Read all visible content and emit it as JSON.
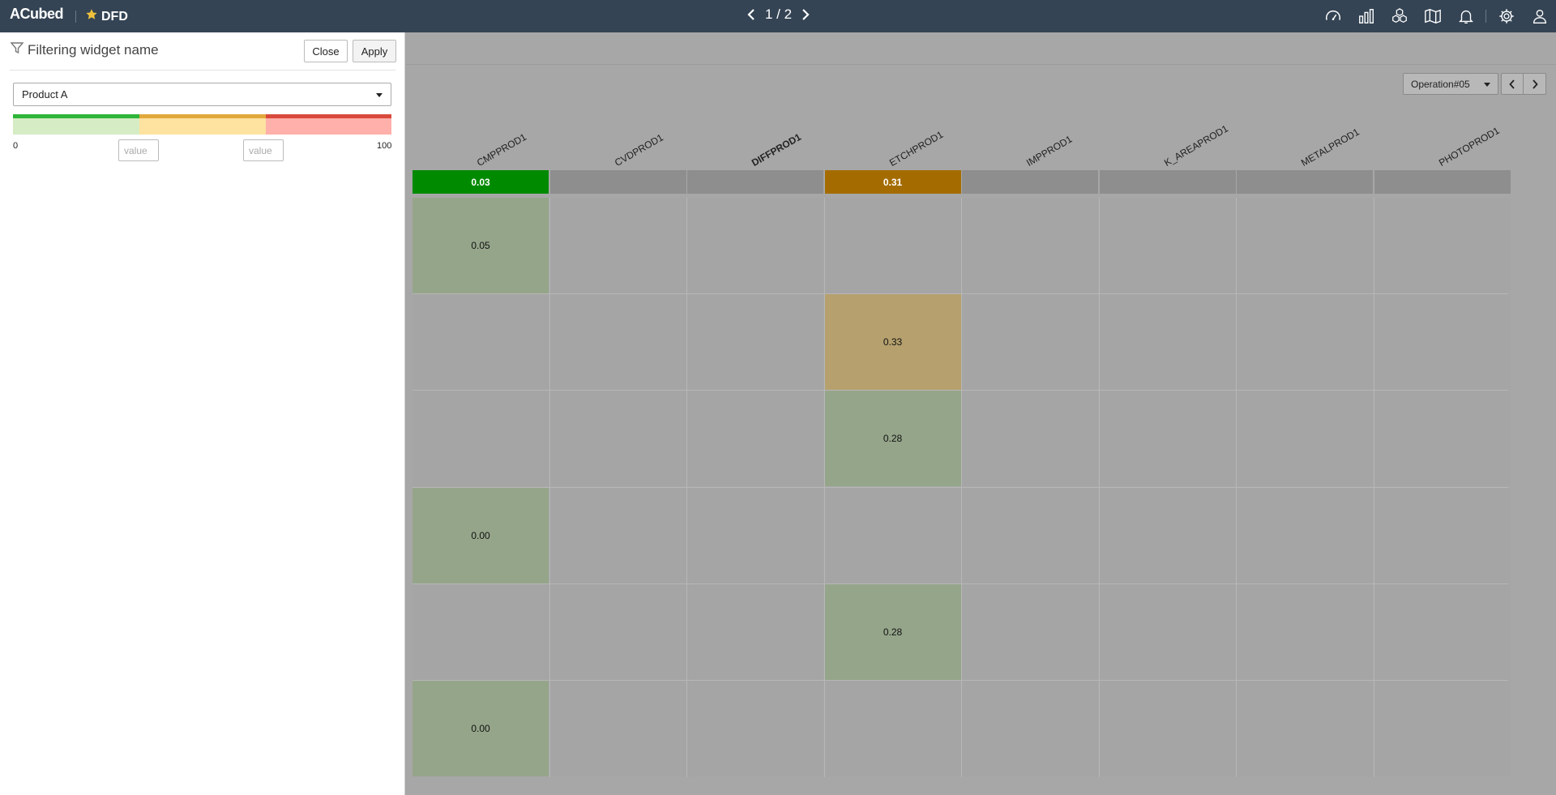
{
  "app": {
    "brand": "ACubed",
    "dashboard_title": "DFD"
  },
  "pager": {
    "label": "1 / 2"
  },
  "top_icons": [
    "speedometer-icon",
    "bar-chart-icon",
    "cubes-icon",
    "map-icon",
    "bell-icon",
    "gear-icon",
    "user-icon"
  ],
  "filter_panel": {
    "title": "Filtering widget name",
    "close_label": "Close",
    "apply_label": "Apply",
    "product_select": "Product A",
    "range_min": "0",
    "range_max": "100",
    "value_placeholder": "value",
    "colors": {
      "green": "#2eb53a",
      "yellow": "#e1a83c",
      "red": "#d94a3c"
    }
  },
  "main": {
    "operation_select": "Operation#05",
    "columns": [
      "CMPPROD1",
      "CVDPROD1",
      "DIFFPROD1",
      "ETCHPROD1",
      "IMPPROD1",
      "K_AREAPROD1",
      "METALPROD1",
      "PHOTOPROD1"
    ],
    "bold_column": "DIFFPROD1",
    "summary": [
      "0.03",
      "",
      "",
      "0.31",
      "",
      "",
      "",
      ""
    ],
    "summary_colors": [
      "#008a00",
      "",
      "",
      "#a46c00",
      "",
      "",
      "",
      ""
    ],
    "rows": [
      [
        "0.05",
        "",
        "",
        "",
        "",
        "",
        "",
        ""
      ],
      [
        "",
        "",
        "",
        "0.33",
        "",
        "",
        "",
        ""
      ],
      [
        "",
        "",
        "",
        "0.28",
        "",
        "",
        "",
        ""
      ],
      [
        "0.00",
        "",
        "",
        "",
        "",
        "",
        "",
        ""
      ],
      [
        "",
        "",
        "",
        "0.28",
        "",
        "",
        "",
        ""
      ],
      [
        "0.00",
        "",
        "",
        "",
        "",
        "",
        "",
        ""
      ]
    ],
    "cell_colors": {
      "green": "#95a58a",
      "orange": "#b5a06e"
    }
  }
}
